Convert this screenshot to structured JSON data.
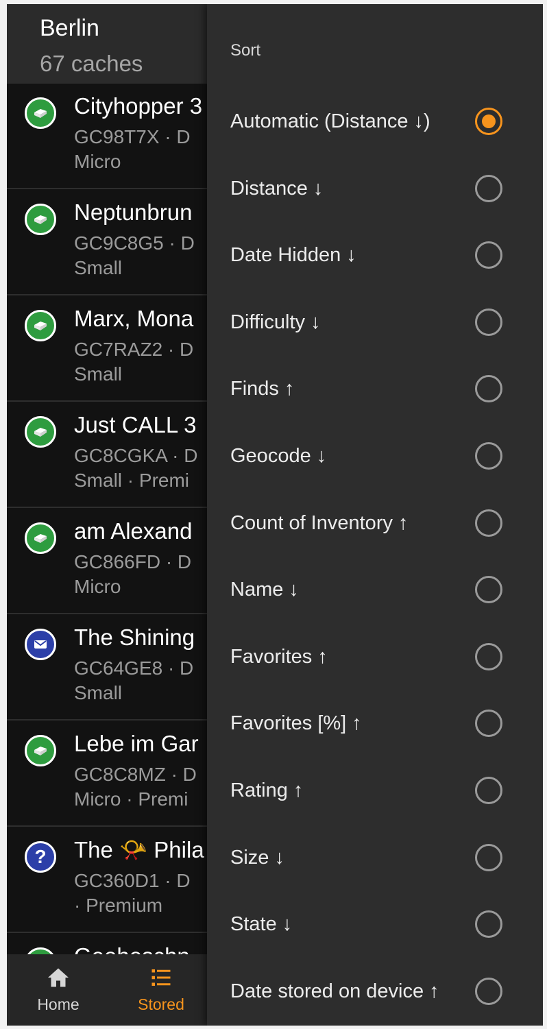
{
  "colors": {
    "accent": "#f7941d",
    "traditional": "#2e9c3f",
    "letterbox": "#2c3fa8",
    "mystery": "#2c3fa8"
  },
  "header": {
    "title": "Berlin",
    "subtitle": "67 caches"
  },
  "caches": [
    {
      "icon": "traditional-cache-icon",
      "name": "Cityhopper 3",
      "code": "GC98T7X · D",
      "size": "Micro"
    },
    {
      "icon": "traditional-cache-icon",
      "name": "Neptunbrun",
      "code": "GC9C8G5 · D",
      "size": "Small"
    },
    {
      "icon": "traditional-cache-icon",
      "name": "Marx, Mona",
      "code": "GC7RAZ2 · D",
      "size": "Small"
    },
    {
      "icon": "traditional-cache-icon",
      "name": "Just CALL 3",
      "code": "GC8CGKA · D",
      "size": "Small · Premi"
    },
    {
      "icon": "traditional-cache-icon",
      "name": "am Alexand",
      "code": "GC866FD · D",
      "size": "Micro"
    },
    {
      "icon": "letterbox-cache-icon",
      "name": "The Shining",
      "code": "GC64GE8 · D",
      "size": "Small"
    },
    {
      "icon": "traditional-cache-icon",
      "name": "Lebe im Gar",
      "code": "GC8C8MZ · D",
      "size": "Micro · Premi"
    },
    {
      "icon": "mystery-cache-icon",
      "name": "The 📯 Phila",
      "code": "GC360D1 · D",
      "size": "· Premium"
    },
    {
      "icon": "traditional-cache-icon",
      "name": "Geoheschn",
      "code": "",
      "size": ""
    }
  ],
  "nav": {
    "home": {
      "label": "Home",
      "icon": "home-icon"
    },
    "stored": {
      "label": "Stored",
      "icon": "list-icon"
    }
  },
  "sort": {
    "title": "Sort",
    "selected_index": 0,
    "options": [
      "Automatic (Distance ↓)",
      "Distance ↓",
      "Date Hidden ↓",
      "Difficulty ↓",
      "Finds ↑",
      "Geocode ↓",
      "Count of Inventory ↑",
      "Name ↓",
      "Favorites ↑",
      "Favorites [%] ↑",
      "Rating ↑",
      "Size ↓",
      "State ↓",
      "Date stored on device ↑"
    ]
  }
}
